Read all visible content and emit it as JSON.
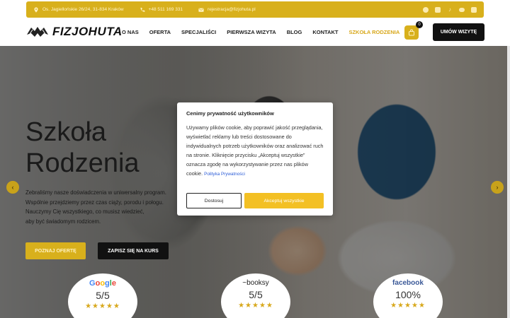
{
  "topbar": {
    "address": "Os. Jagiellońskie 26/24, 31-834 Kraków",
    "phone": "+48 511 169 331",
    "email": "rejestracja@fizjohuta.pl",
    "socials": [
      "facebook-icon",
      "instagram-icon",
      "tiktok-icon",
      "youtube-icon",
      "linkedin-icon"
    ]
  },
  "nav": {
    "logo_text": "FIZJOHUTA",
    "items": [
      "O NAS",
      "OFERTA",
      "SPECJALIŚCI",
      "PIERWSZA WIZYTA",
      "BLOG",
      "KONTAKT",
      "SZKOŁA RODZENIA"
    ],
    "active_item": "SZKOŁA RODZENIA",
    "cart_count": "0",
    "cta": "UMÓW WIZYTĘ"
  },
  "hero": {
    "title_line1": "Szkoła",
    "title_line2": "Rodzenia",
    "desc_line1": "Zebraliśmy nasze doświadczenia w uniwersalny program.",
    "desc_line2": "Wspólnie przejdziemy przez czas ciąży, porodu i połogu.",
    "desc_line3": "Nauczymy Cię wszystkiego, co musisz wiedzieć,",
    "desc_line4": "aby być świadomym rodzicem.",
    "btn_offer": "POZNAJ OFERTĘ",
    "btn_signup": "ZAPISZ SIĘ NA KURS"
  },
  "ratings": [
    {
      "brand": "Google",
      "score": "5/5",
      "stars": "★★★★★"
    },
    {
      "brand": "~booksy",
      "score": "5/5",
      "stars": "★★★★★"
    },
    {
      "brand": "facebook",
      "score": "100%",
      "stars": "★★★★★"
    }
  ],
  "cookie": {
    "title": "Cenimy prywatność użytkowników",
    "text": "Używamy plików cookie, aby poprawić jakość przeglądania, wyświetlać reklamy lub treści dostosowane do indywidualnych potrzeb użytkowników oraz analizować ruch na stronie. Kliknięcie przycisku „Akceptuj wszystkie” oznacza zgodę na wykorzystywanie przez nas plików cookie.",
    "policy_link": "Polityka Prywatności",
    "btn_customize": "Dostosuj",
    "btn_accept": "Akceptuj wszystkie"
  },
  "colors": {
    "accent": "#d8b01c",
    "accept_button": "#f3c024",
    "dark": "#111111",
    "link": "#2a5bd7"
  }
}
